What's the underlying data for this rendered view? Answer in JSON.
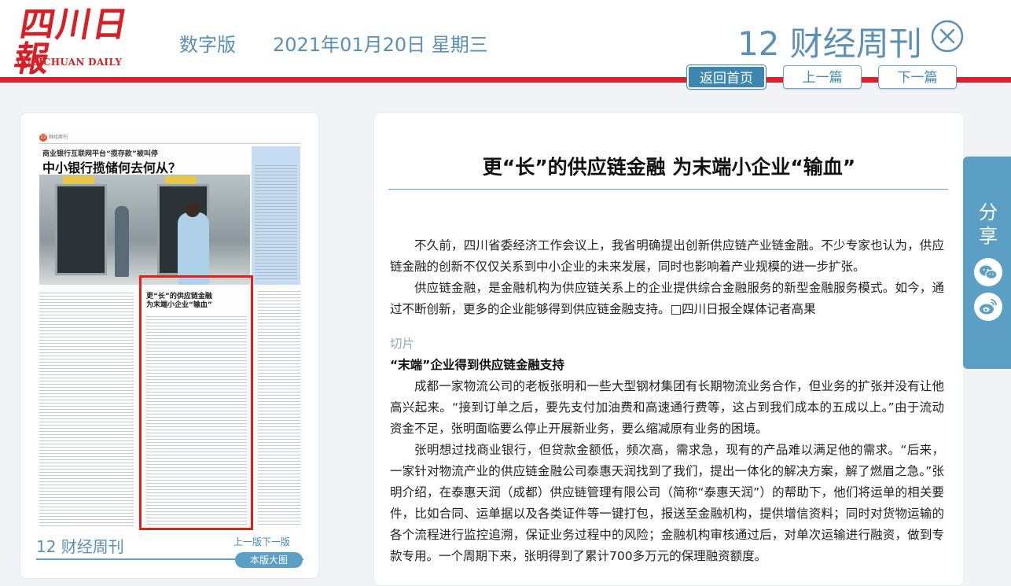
{
  "header": {
    "logo_cn": "四川日報",
    "logo_en": "SICHUAN DAILY",
    "digital_label": "数字版",
    "date": "2021年01月20日 星期三",
    "section": "12 财经周刊"
  },
  "nav": {
    "home": "返回首页",
    "prev": "上一篇",
    "next": "下一篇"
  },
  "thumbnail": {
    "page_badge": "12",
    "header_text": "财经周刊",
    "small_headline": "商业银行互联网平台“揽存款”被叫停",
    "headline": "中小银行揽储何去何从？",
    "highlight_title_1": "更“长”的供应链金融",
    "highlight_title_2": "为末端小企业“输血”",
    "section": "12 财经周刊",
    "prev_page": "上一版",
    "next_page": "下一版",
    "full_page": "本版大图"
  },
  "article": {
    "title": "更“长”的供应链金融 为末端小企业“输血”",
    "paragraphs": [
      "不久前，四川省委经济工作会议上，我省明确提出创新供应链产业链金融。不少专家也认为，供应链金融的创新不仅仅关系到中小企业的未来发展，同时也影响着产业规模的进一步扩张。",
      "供应链金融，是金融机构为供应链关系上的企业提供综合金融服务的新型金融服务模式。如今，通过不断创新，更多的企业能够得到供应链金融支持。□四川日报全媒体记者高果"
    ],
    "tag": "切片",
    "subhead": "“末端”企业得到供应链金融支持",
    "paragraphs2": [
      "成都一家物流公司的老板张明和一些大型钢材集团有长期物流业务合作，但业务的扩张并没有让他高兴起来。“接到订单之后，要先支付加油费和高速通行费等，这占到我们成本的五成以上。”由于流动资金不足，张明面临要么停止开展新业务，要么缩减原有业务的困境。",
      "张明想过找商业银行，但贷款金额低，频次高，需求急，现有的产品难以满足他的需求。“后来，一家针对物流产业的供应链金融公司泰惠天润找到了我们，提出一体化的解决方案，解了燃眉之急。”张明介绍，在泰惠天润（成都）供应链管理有限公司（简称“泰惠天润”）的帮助下，他们将运单的相关要件，比如合同、运单据以及各类证件等一键打包，报送至金融机构，提供增信资料；同时对货物运输的各个流程进行监控追溯，保证业务过程中的风险；金融机构审核通过后，对单次运输进行融资，做到专款专用。一个周期下来，张明得到了累计700多万元的保理融资额度。"
    ]
  },
  "share": {
    "label": "分享",
    "icons": [
      "wechat-icon",
      "weibo-icon"
    ]
  },
  "colors": {
    "accent_blue": "#5b9fc4",
    "brand_red": "#d81f26",
    "rule_red": "#e21f2f"
  }
}
